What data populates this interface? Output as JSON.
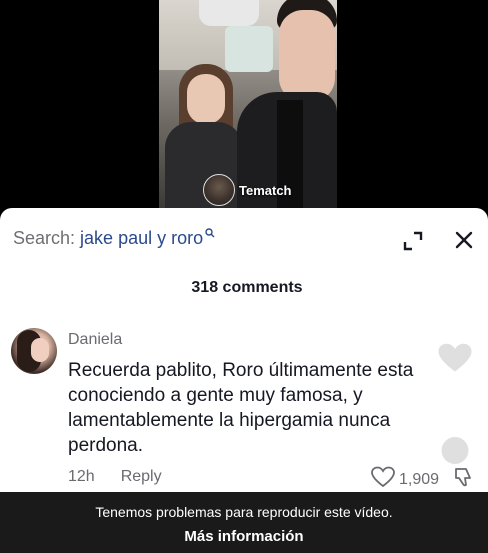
{
  "video": {
    "watermark_label": "Tematch"
  },
  "search": {
    "prefix": "Search:",
    "query": "jake paul y roro"
  },
  "comments": {
    "count_label": "318 comments",
    "items": [
      {
        "username": "Daniela",
        "text": "Recuerda pablito, Roro últimamente esta\nconociendo a gente muy famosa, y\nlamentablemente la hipergamia nunca\nperdona.",
        "time": "12h",
        "reply_label": "Reply",
        "likes": "1,909"
      }
    ]
  },
  "overlay": {
    "message": "Tenemos problemas para reproducir este vídeo.",
    "link_label": "Más información"
  },
  "colors": {
    "search_query": "#2a4a8c",
    "text_primary": "#161823",
    "text_secondary": "#6a6a70",
    "overlay_bg": "#1a1a1a"
  },
  "icons": {
    "search_mini": "search-icon",
    "expand": "expand-icon",
    "close": "close-icon",
    "like": "heart-icon",
    "dislike": "thumbs-down-icon"
  }
}
